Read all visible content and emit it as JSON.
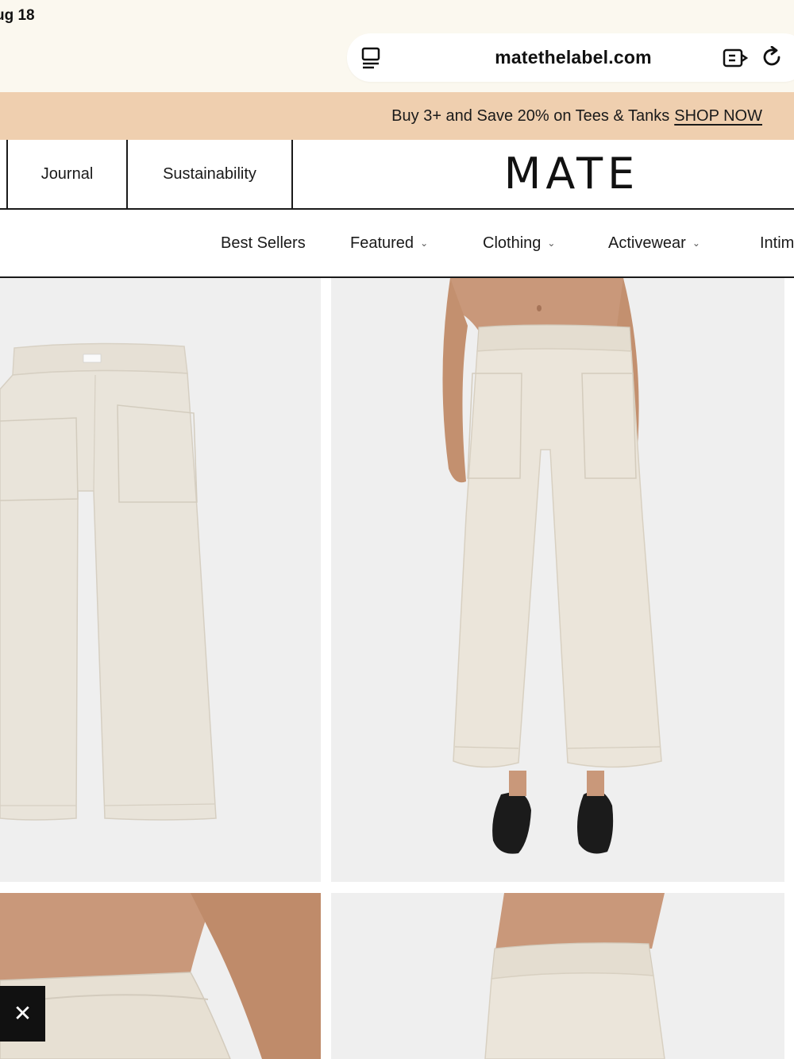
{
  "status_bar": {
    "date": "ug 18"
  },
  "browser": {
    "url": "matethelabel.com",
    "icons": {
      "tabs": "tab-overview-icon",
      "reader": "reader-mode-icon",
      "reload": "reload-icon"
    }
  },
  "promo": {
    "text": "Buy 3+ and Save 20% on Tees & Tanks",
    "link": "SHOP NOW",
    "background": "#efcfaf"
  },
  "topnav": {
    "items": [
      "Journal",
      "Sustainability"
    ],
    "logo": "MATE"
  },
  "catnav": {
    "items": [
      {
        "label": "Best Sellers",
        "has_dropdown": false
      },
      {
        "label": "Featured",
        "has_dropdown": true
      },
      {
        "label": "Clothing",
        "has_dropdown": true
      },
      {
        "label": "Activewear",
        "has_dropdown": true
      },
      {
        "label": "Intim",
        "has_dropdown": false
      }
    ]
  },
  "products": [
    {
      "image": "cream wide-leg pants flat lay"
    },
    {
      "image": "cream wide-leg pants on model with black flats"
    },
    {
      "image": "cream pants waistband on model"
    },
    {
      "image": "cream pants waistband on model"
    }
  ],
  "overlay": {
    "close": "✕"
  },
  "colors": {
    "cream": "#e9e3d8",
    "tile_bg": "#eeeeee",
    "ink": "#111111"
  }
}
